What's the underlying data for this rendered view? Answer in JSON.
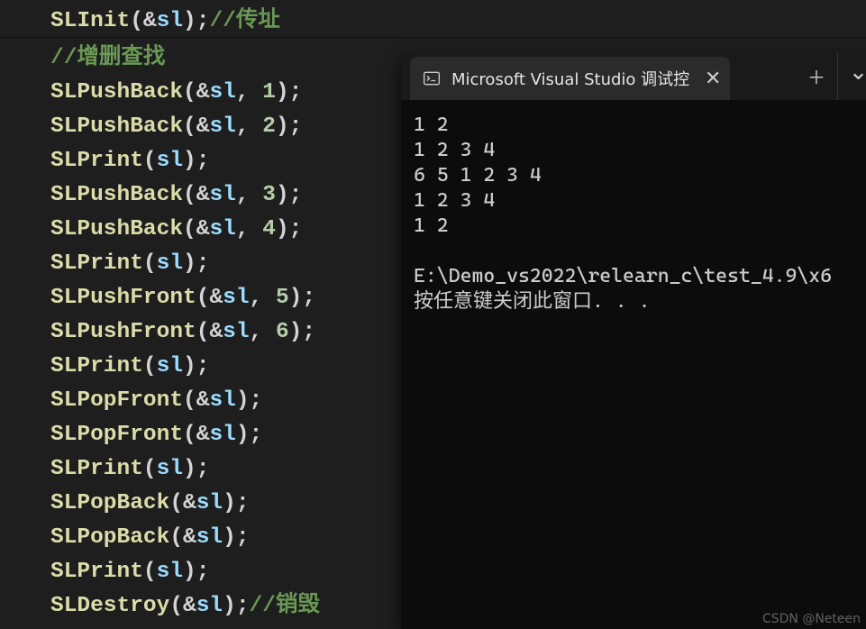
{
  "editor": {
    "lines": [
      {
        "segments": [
          {
            "text": "SLInit",
            "cls": "fn"
          },
          {
            "text": "(",
            "cls": "paren"
          },
          {
            "text": "&",
            "cls": "amp"
          },
          {
            "text": "sl",
            "cls": "var"
          },
          {
            "text": ");",
            "cls": "semi"
          },
          {
            "text": "//传址",
            "cls": "comment"
          }
        ],
        "inTop": true
      },
      {
        "segments": [
          {
            "text": "//增删查找",
            "cls": "comment"
          }
        ]
      },
      {
        "segments": [
          {
            "text": "SLPushBack",
            "cls": "fn"
          },
          {
            "text": "(",
            "cls": "paren"
          },
          {
            "text": "&",
            "cls": "amp"
          },
          {
            "text": "sl",
            "cls": "var"
          },
          {
            "text": ", ",
            "cls": "comma"
          },
          {
            "text": "1",
            "cls": "num"
          },
          {
            "text": ");",
            "cls": "semi"
          }
        ]
      },
      {
        "segments": [
          {
            "text": "SLPushBack",
            "cls": "fn"
          },
          {
            "text": "(",
            "cls": "paren"
          },
          {
            "text": "&",
            "cls": "amp"
          },
          {
            "text": "sl",
            "cls": "var"
          },
          {
            "text": ", ",
            "cls": "comma"
          },
          {
            "text": "2",
            "cls": "num"
          },
          {
            "text": ");",
            "cls": "semi"
          }
        ]
      },
      {
        "segments": [
          {
            "text": "SLPrint",
            "cls": "fn"
          },
          {
            "text": "(",
            "cls": "paren"
          },
          {
            "text": "sl",
            "cls": "var"
          },
          {
            "text": ");",
            "cls": "semi"
          }
        ]
      },
      {
        "segments": [
          {
            "text": "SLPushBack",
            "cls": "fn"
          },
          {
            "text": "(",
            "cls": "paren"
          },
          {
            "text": "&",
            "cls": "amp"
          },
          {
            "text": "sl",
            "cls": "var"
          },
          {
            "text": ", ",
            "cls": "comma"
          },
          {
            "text": "3",
            "cls": "num"
          },
          {
            "text": ");",
            "cls": "semi"
          }
        ]
      },
      {
        "segments": [
          {
            "text": "SLPushBack",
            "cls": "fn"
          },
          {
            "text": "(",
            "cls": "paren"
          },
          {
            "text": "&",
            "cls": "amp"
          },
          {
            "text": "sl",
            "cls": "var"
          },
          {
            "text": ", ",
            "cls": "comma"
          },
          {
            "text": "4",
            "cls": "num"
          },
          {
            "text": ");",
            "cls": "semi"
          }
        ]
      },
      {
        "segments": [
          {
            "text": "SLPrint",
            "cls": "fn"
          },
          {
            "text": "(",
            "cls": "paren"
          },
          {
            "text": "sl",
            "cls": "var"
          },
          {
            "text": ");",
            "cls": "semi"
          }
        ]
      },
      {
        "segments": [
          {
            "text": "SLPushFront",
            "cls": "fn"
          },
          {
            "text": "(",
            "cls": "paren"
          },
          {
            "text": "&",
            "cls": "amp"
          },
          {
            "text": "sl",
            "cls": "var"
          },
          {
            "text": ", ",
            "cls": "comma"
          },
          {
            "text": "5",
            "cls": "num"
          },
          {
            "text": ");",
            "cls": "semi"
          }
        ]
      },
      {
        "segments": [
          {
            "text": "SLPushFront",
            "cls": "fn"
          },
          {
            "text": "(",
            "cls": "paren"
          },
          {
            "text": "&",
            "cls": "amp"
          },
          {
            "text": "sl",
            "cls": "var"
          },
          {
            "text": ", ",
            "cls": "comma"
          },
          {
            "text": "6",
            "cls": "num"
          },
          {
            "text": ");",
            "cls": "semi"
          }
        ]
      },
      {
        "segments": [
          {
            "text": "SLPrint",
            "cls": "fn"
          },
          {
            "text": "(",
            "cls": "paren"
          },
          {
            "text": "sl",
            "cls": "var"
          },
          {
            "text": ");",
            "cls": "semi"
          }
        ]
      },
      {
        "segments": [
          {
            "text": "SLPopFront",
            "cls": "fn"
          },
          {
            "text": "(",
            "cls": "paren"
          },
          {
            "text": "&",
            "cls": "amp"
          },
          {
            "text": "sl",
            "cls": "var"
          },
          {
            "text": ");",
            "cls": "semi"
          }
        ]
      },
      {
        "segments": [
          {
            "text": "SLPopFront",
            "cls": "fn"
          },
          {
            "text": "(",
            "cls": "paren"
          },
          {
            "text": "&",
            "cls": "amp"
          },
          {
            "text": "sl",
            "cls": "var"
          },
          {
            "text": ");",
            "cls": "semi"
          }
        ]
      },
      {
        "segments": [
          {
            "text": "SLPrint",
            "cls": "fn"
          },
          {
            "text": "(",
            "cls": "paren"
          },
          {
            "text": "sl",
            "cls": "var"
          },
          {
            "text": ");",
            "cls": "semi"
          }
        ]
      },
      {
        "segments": [
          {
            "text": "SLPopBack",
            "cls": "fn"
          },
          {
            "text": "(",
            "cls": "paren"
          },
          {
            "text": "&",
            "cls": "amp"
          },
          {
            "text": "sl",
            "cls": "var"
          },
          {
            "text": ");",
            "cls": "semi"
          }
        ]
      },
      {
        "segments": [
          {
            "text": "SLPopBack",
            "cls": "fn"
          },
          {
            "text": "(",
            "cls": "paren"
          },
          {
            "text": "&",
            "cls": "amp"
          },
          {
            "text": "sl",
            "cls": "var"
          },
          {
            "text": ");",
            "cls": "semi"
          }
        ]
      },
      {
        "segments": [
          {
            "text": "SLPrint",
            "cls": "fn"
          },
          {
            "text": "(",
            "cls": "paren"
          },
          {
            "text": "sl",
            "cls": "var"
          },
          {
            "text": ");",
            "cls": "semi"
          }
        ]
      },
      {
        "segments": [
          {
            "text": "SLDestroy",
            "cls": "fn"
          },
          {
            "text": "(",
            "cls": "paren"
          },
          {
            "text": "&",
            "cls": "amp"
          },
          {
            "text": "sl",
            "cls": "var"
          },
          {
            "text": ");",
            "cls": "semi"
          },
          {
            "text": "//销毁",
            "cls": "comment"
          }
        ]
      }
    ]
  },
  "terminal": {
    "tab_title": "Microsoft Visual Studio 调试控",
    "output_lines": [
      "1 2",
      "1 2 3 4",
      "6 5 1 2 3 4",
      "1 2 3 4",
      "1 2",
      "",
      "E:\\Demo_vs2022\\relearn_c\\test_4.9\\x6",
      "按任意键关闭此窗口. . ."
    ],
    "close_glyph": "✕",
    "plus_glyph": "＋",
    "chevron_glyph": "⌄"
  },
  "watermark": "CSDN @Neteen"
}
